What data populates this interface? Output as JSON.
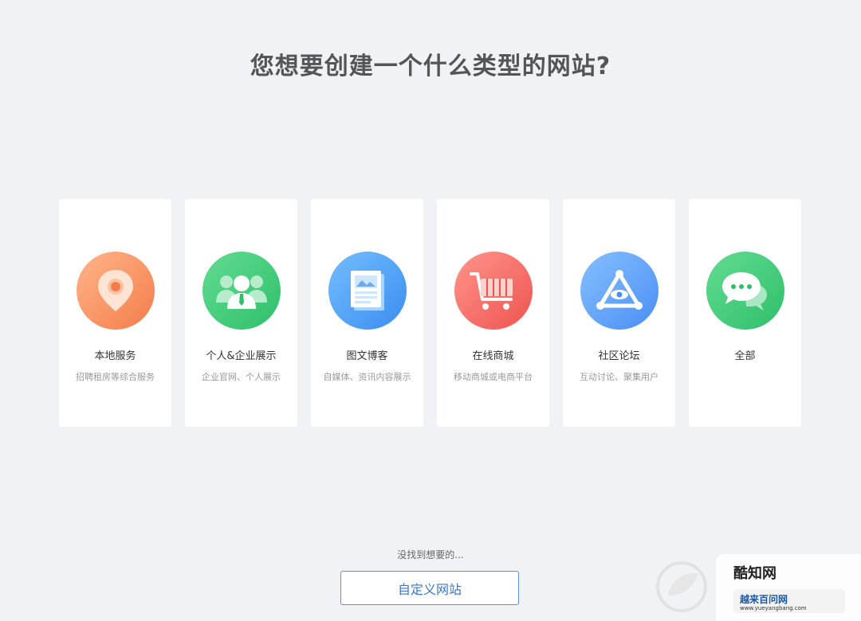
{
  "page": {
    "title": "您想要创建一个什么类型的网站?"
  },
  "cards": [
    {
      "name": "本地服务",
      "desc": "招聘租房等综合服务",
      "icon": "location-pin-icon",
      "color_from": "#ffb07a",
      "color_to": "#f47c4a"
    },
    {
      "name": "个人&企业展示",
      "desc": "企业官网、个人展示",
      "icon": "users-icon",
      "color_from": "#5bd88c",
      "color_to": "#2fbf6a"
    },
    {
      "name": "图文博客",
      "desc": "自媒体、资讯内容展示",
      "icon": "newspaper-icon",
      "color_from": "#6cb8ff",
      "color_to": "#3a8ef0"
    },
    {
      "name": "在线商城",
      "desc": "移动商城或电商平台",
      "icon": "shopping-cart-icon",
      "color_from": "#ff8a80",
      "color_to": "#ef5350"
    },
    {
      "name": "社区论坛",
      "desc": "互动讨论、聚集用户",
      "icon": "community-triangle-icon",
      "color_from": "#7fb8ff",
      "color_to": "#4a8ef5"
    },
    {
      "name": "全部",
      "desc": "",
      "icon": "chat-bubble-icon",
      "color_from": "#5bd88c",
      "color_to": "#2fbf6a"
    }
  ],
  "footer": {
    "hint": "没找到想要的...",
    "custom_button": "自定义网站"
  },
  "watermark": {
    "brand": "酷知网",
    "sub": "越来百问网",
    "url": "www.yueyangbang.com"
  }
}
